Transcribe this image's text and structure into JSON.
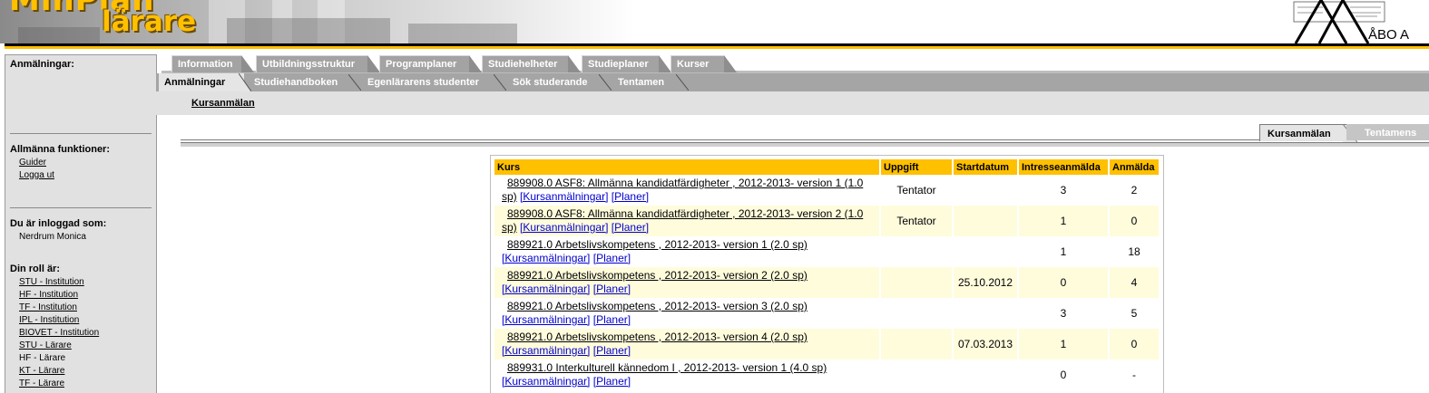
{
  "header": {
    "logo_top": "MinPlan",
    "logo_bottom": "lärare",
    "university": "ÅBO A"
  },
  "sidebar": {
    "registrations_heading": "Anmälningar:",
    "general_heading": "Allmänna funktioner:",
    "general_links": [
      "Guider",
      "Logga ut"
    ],
    "logged_in_heading": "Du är inloggad som:",
    "user_name": "Nerdrum Monica",
    "role_heading": "Din roll är:",
    "roles": [
      {
        "label": "STU - Institution",
        "link": true
      },
      {
        "label": "HF - Institution",
        "link": true
      },
      {
        "label": "TF - Institution",
        "link": true
      },
      {
        "label": "IPL - Institution",
        "link": true
      },
      {
        "label": "BIOVET - Institution",
        "link": true
      },
      {
        "label": "STU - Lärare",
        "link": true
      },
      {
        "label": "HF - Lärare",
        "link": false
      },
      {
        "label": "KT - Lärare",
        "link": true
      },
      {
        "label": "TF - Lärare",
        "link": true
      }
    ]
  },
  "tabs_top": [
    "Information",
    "Utbildningsstruktur",
    "Programplaner",
    "Studiehelheter",
    "Studieplaner",
    "Kurser"
  ],
  "tabs_second": [
    "Anmälningar",
    "Studiehandboken",
    "Egenlärarens studenter",
    "Sök studerande",
    "Tentamen"
  ],
  "active_second_tab": "Anmälningar",
  "sub_link": "Kursanmälan",
  "right_tabs": [
    "Kursanmälan",
    "Tentamens"
  ],
  "table": {
    "headers": [
      "Kurs",
      "Uppgift",
      "Startdatum",
      "Intresseanmälda",
      "Anmälda"
    ],
    "rows": [
      {
        "name": "889908.0 ASF8: Allmänna kandidatfärdigheter , 2012-2013- version 1 (1.0",
        "name_tail": "sp)",
        "links": [
          "[Kursanmälningar]",
          "[Planer]"
        ],
        "uppgift": "Tentator",
        "start": "",
        "intresse": "3",
        "anmalda": "2"
      },
      {
        "name": "889908.0 ASF8: Allmänna kandidatfärdigheter , 2012-2013- version 2 (1.0",
        "name_tail": "sp)",
        "links": [
          "[Kursanmälningar]",
          "[Planer]"
        ],
        "uppgift": "Tentator",
        "start": "",
        "intresse": "1",
        "anmalda": "0"
      },
      {
        "name": "889921.0 Arbetslivskompetens , 2012-2013- version 1 (2.0 sp)",
        "name_tail": "",
        "links": [
          "[Kursanmälningar]",
          "[Planer]"
        ],
        "uppgift": "",
        "start": "",
        "intresse": "1",
        "anmalda": "18"
      },
      {
        "name": "889921.0 Arbetslivskompetens , 2012-2013- version 2 (2.0 sp)",
        "name_tail": "",
        "links": [
          "[Kursanmälningar]",
          "[Planer]"
        ],
        "uppgift": "",
        "start": "25.10.2012",
        "intresse": "0",
        "anmalda": "4"
      },
      {
        "name": "889921.0 Arbetslivskompetens , 2012-2013- version 3 (2.0 sp)",
        "name_tail": "",
        "links": [
          "[Kursanmälningar]",
          "[Planer]"
        ],
        "uppgift": "",
        "start": "",
        "intresse": "3",
        "anmalda": "5"
      },
      {
        "name": "889921.0 Arbetslivskompetens , 2012-2013- version 4 (2.0 sp)",
        "name_tail": "",
        "links": [
          "[Kursanmälningar]",
          "[Planer]"
        ],
        "uppgift": "",
        "start": "07.03.2013",
        "intresse": "1",
        "anmalda": "0"
      },
      {
        "name": "889931.0 Interkulturell kännedom I , 2012-2013- version 1 (4.0 sp)",
        "name_tail": "",
        "links": [
          "[Kursanmälningar]",
          "[Planer]"
        ],
        "uppgift": "",
        "start": "",
        "intresse": "0",
        "anmalda": "-"
      }
    ]
  }
}
